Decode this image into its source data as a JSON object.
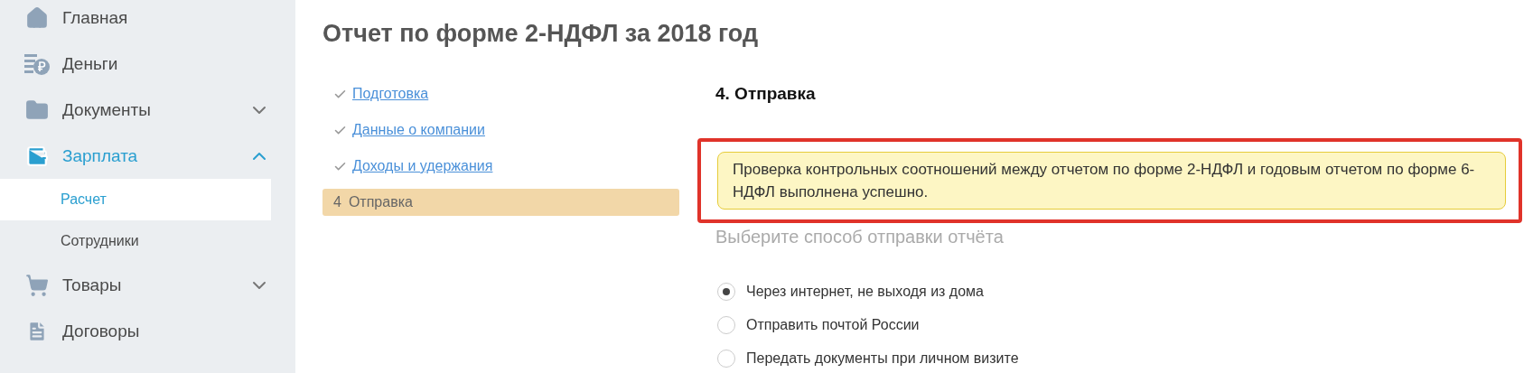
{
  "sidebar": {
    "items": [
      {
        "label": "Главная",
        "selected": false
      },
      {
        "label": "Деньги",
        "selected": false
      },
      {
        "label": "Документы",
        "selected": false,
        "expanded": false
      },
      {
        "label": "Зарплата",
        "selected": true,
        "expanded": true,
        "children": [
          {
            "label": "Расчет",
            "selected": true
          },
          {
            "label": "Сотрудники",
            "selected": false
          }
        ]
      },
      {
        "label": "Товары",
        "selected": false,
        "expanded": false
      },
      {
        "label": "Договоры",
        "selected": false
      }
    ]
  },
  "page": {
    "title": "Отчет по форме 2-НДФЛ за 2018 год",
    "steps": [
      {
        "label": "Подготовка",
        "done": true,
        "selected": false
      },
      {
        "label": "Данные о компании",
        "done": true,
        "selected": false
      },
      {
        "label": "Доходы и удержания",
        "done": true,
        "selected": false
      },
      {
        "number": "4",
        "label": "Отправка",
        "done": false,
        "selected": true
      }
    ],
    "section_title": "4. Отправка",
    "notice": {
      "text": "Проверка контрольных соотношений между отчетом по форме 2-НДФЛ и годовым отчетом по форме 6-НДФЛ выполнена успешно.",
      "highlighted": true
    },
    "choose_label": "Выберите способ отправки отчёта",
    "options": [
      {
        "label": "Через интернет, не выходя из дома",
        "selected": true
      },
      {
        "label": "Отправить почтой России",
        "selected": false
      },
      {
        "label": "Передать документы при личном визите",
        "selected": false
      }
    ]
  }
}
